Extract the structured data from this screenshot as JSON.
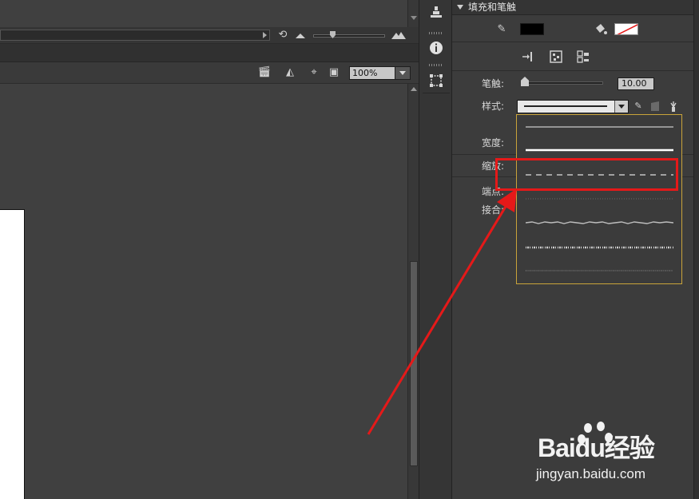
{
  "timeline": {
    "loop_icon": "loop-icon",
    "zoom_small_icon": "mountain-small-icon",
    "zoom_large_icon": "mountain-large-icon"
  },
  "edit_bar": {
    "icons": [
      "clapper-board-icon",
      "symbol-edit-icon",
      "center-stage-icon",
      "clip-stage-icon"
    ],
    "zoom_value": "100%"
  },
  "dock": {
    "icons": [
      "align-panel-icon",
      "info-icon",
      "transform-icon"
    ]
  },
  "properties": {
    "section_title": "填充和笔触",
    "stroke_color": "#000000",
    "fill_color": "none",
    "align_icons": [
      "align-to-path-icon",
      "align-grid-icon",
      "align-distribute-icon"
    ],
    "labels": {
      "stroke": "笔触:",
      "style": "样式:",
      "width": "宽度:",
      "scale": "缩放:",
      "cap": "端点:",
      "join": "接合:"
    },
    "stroke_value": "10.00",
    "stroke_slider_fraction": 0.01,
    "style_selected": "solid",
    "style_options": [
      "hairline",
      "solid",
      "dashed",
      "dotted",
      "ragged",
      "stipple",
      "hatched"
    ],
    "highlighted_option": "dashed"
  },
  "annotation": {
    "color": "#e51919"
  },
  "watermark": {
    "brand": "Baidu经验",
    "url": "jingyan.baidu.com"
  }
}
